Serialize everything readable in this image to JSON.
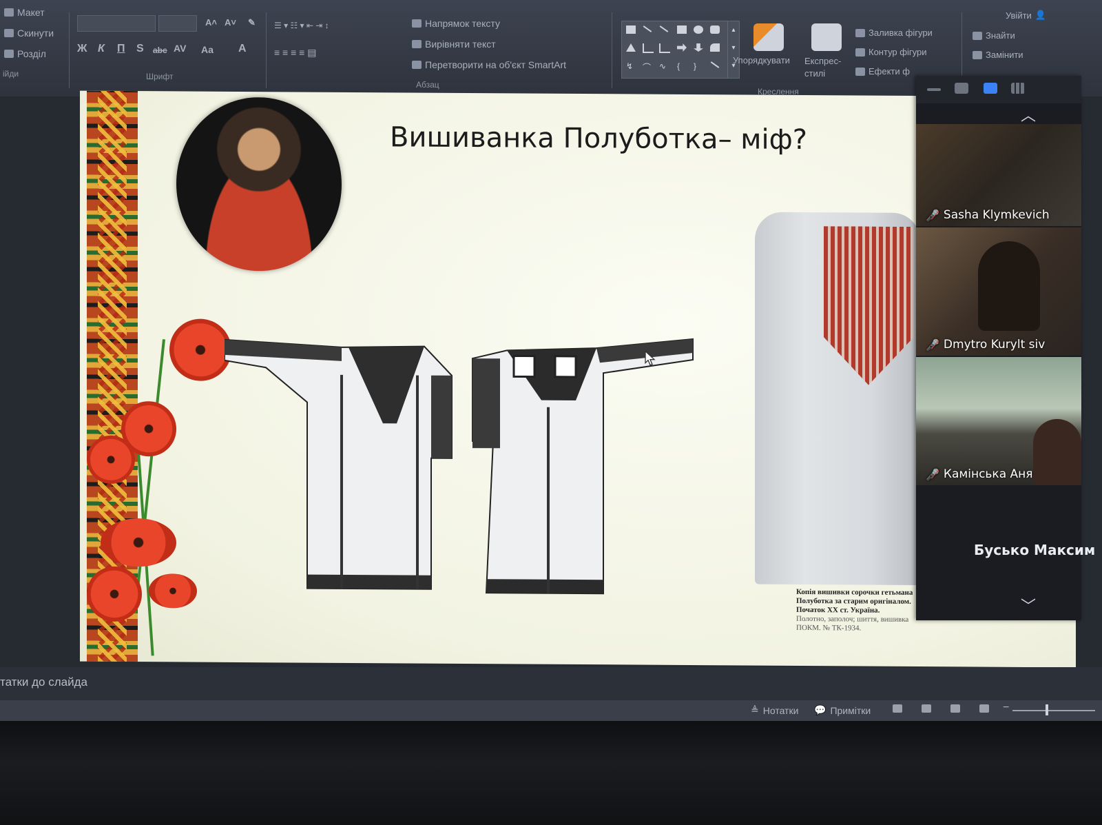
{
  "ribbon": {
    "slides_group": {
      "layout_label": "Макет",
      "reset_label": "Скинути",
      "section_label": "Розділ",
      "group_label": "ійди"
    },
    "font_group": {
      "label": "Шрифт",
      "bold": "Ж",
      "italic": "К",
      "underline": "П",
      "shadow": "S",
      "strike": "abc",
      "spacing": "AV",
      "case": "Aa",
      "color": "A"
    },
    "paragraph_group": {
      "label": "Абзац",
      "text_direction": "Напрямок тексту",
      "align_text": "Вирівняти текст",
      "smartart": "Перетворити на об'єкт SmartArt"
    },
    "drawing_group": {
      "label": "Креслення",
      "arrange": "Упорядкувати",
      "quick_styles": "Експрес-стилі",
      "shape_fill": "Заливка фігури",
      "shape_outline": "Контур фігури",
      "shape_effects": "Ефекти ф"
    },
    "editing_group": {
      "find": "Знайти",
      "replace": "Замінити"
    },
    "account": "Увійти"
  },
  "slide": {
    "title": "Вишиванка Полуботка– міф?",
    "caption_lines": [
      "Копія вишивки сорочки гетьмана",
      "Полуботка за старим оригіналом.",
      "Початок XX ст. Україна."
    ],
    "caption_sub_lines": [
      "Полотно, заполоч; шиття, вишивка",
      "ПОКМ. № ТК-1934."
    ]
  },
  "participants": [
    {
      "name": "Sasha Klymkevich",
      "muted": true
    },
    {
      "name": "Dmytro Kurylt siv",
      "muted": true
    },
    {
      "name": "Камінська Аня",
      "muted": true
    },
    {
      "name": "Бусько Максим",
      "muted": false
    }
  ],
  "notes": {
    "placeholder": "татки до слайда"
  },
  "status": {
    "notes_label": "Нотатки",
    "comments_label": "Примітки"
  },
  "colors": {
    "accent_mic_off": "#e64a3c",
    "video_active": "#3b82f6"
  }
}
